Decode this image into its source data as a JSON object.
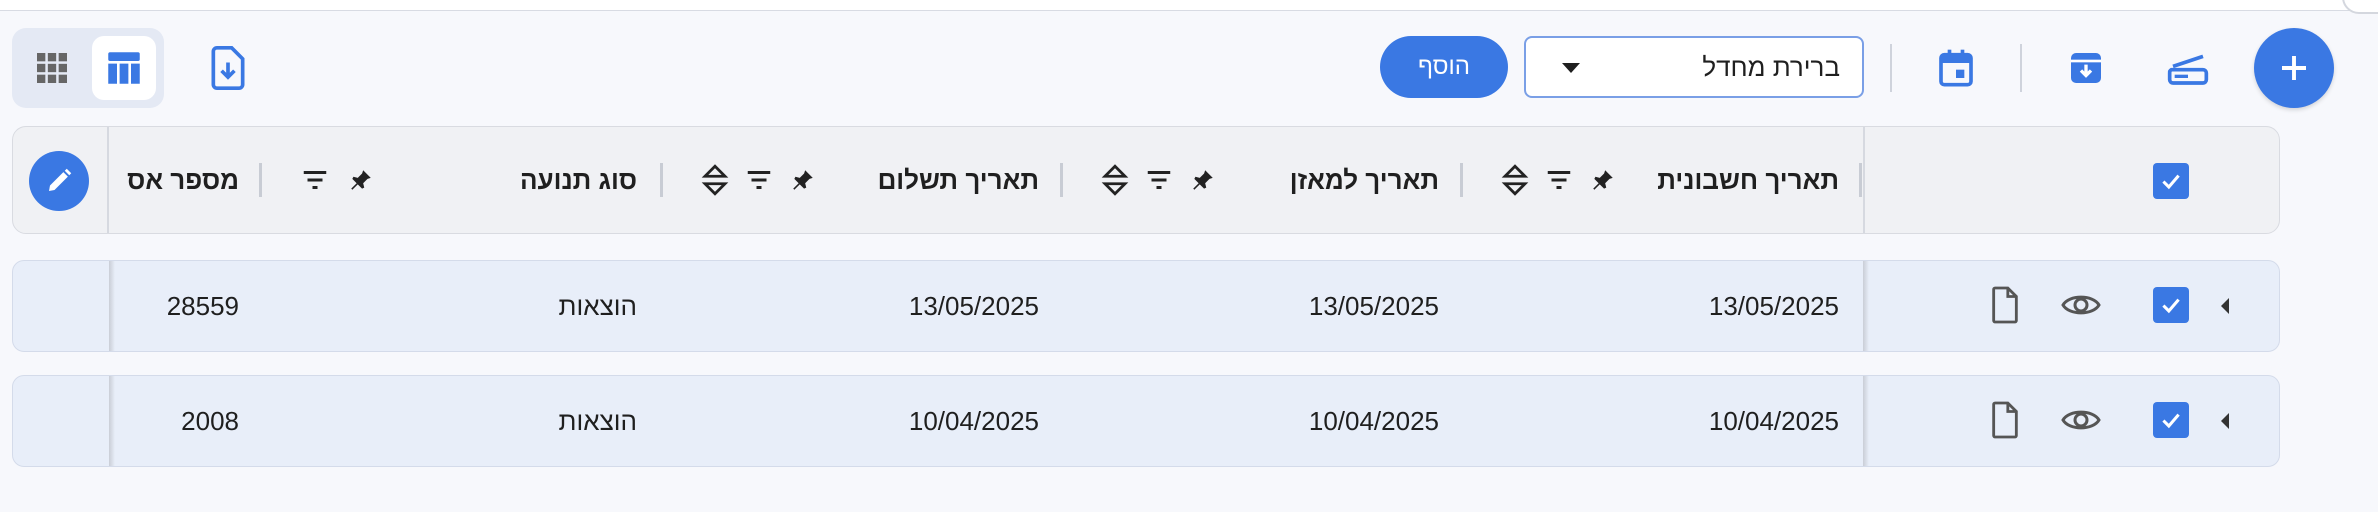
{
  "toolbar": {
    "add_button_label": "הוסף",
    "select_value": "ברירת מחדל"
  },
  "table": {
    "headers": {
      "invoice_date": "תאריך חשבונית",
      "balance_date": "תאריך למאזן",
      "payment_date": "תאריך תשלום",
      "movement_type": "סוג תנועה",
      "doc_number": "מספר אס"
    },
    "rows": [
      {
        "invoice_date": "13/05/2025",
        "balance_date": "13/05/2025",
        "payment_date": "13/05/2025",
        "movement_type": "הוצאות",
        "doc_number": "28559",
        "checked": true
      },
      {
        "invoice_date": "10/04/2025",
        "balance_date": "10/04/2025",
        "payment_date": "10/04/2025",
        "movement_type": "הוצאות",
        "doc_number": "2008",
        "checked": true
      }
    ]
  },
  "icons": {
    "grid_view": "grid-icon",
    "table_view": "table-icon",
    "export": "file-download-icon",
    "add": "plus-icon",
    "scanner": "scanner-icon",
    "archive": "archive-download-icon",
    "calendar": "calendar-icon",
    "pin": "pin-icon",
    "filter": "filter-icon",
    "sort": "sort-icon",
    "edit": "pencil-icon",
    "view": "eye-icon",
    "document": "document-icon"
  },
  "colors": {
    "accent": "#3a78e3",
    "row_background": "#e8eef9",
    "header_background": "#f0f1f4"
  }
}
